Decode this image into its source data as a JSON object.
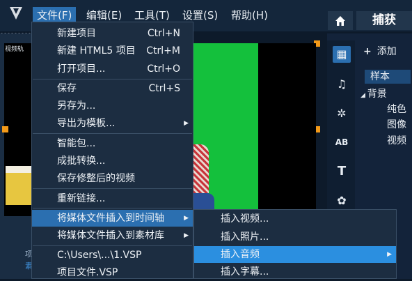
{
  "menubar": {
    "items": [
      "文件(F)",
      "编辑(E)",
      "工具(T)",
      "设置(S)",
      "帮助(H)"
    ]
  },
  "header": {
    "capture_label": "捕获"
  },
  "preview": {
    "track_label": "视频轨"
  },
  "file_menu": {
    "groups": [
      [
        {
          "label": "新建项目",
          "shortcut": "Ctrl+N"
        },
        {
          "label": "新建 HTML5 项目",
          "shortcut": "Ctrl+M"
        },
        {
          "label": "打开项目...",
          "shortcut": "Ctrl+O"
        }
      ],
      [
        {
          "label": "保存",
          "shortcut": "Ctrl+S"
        },
        {
          "label": "另存为..."
        },
        {
          "label": "导出为模板...",
          "submenu": true
        }
      ],
      [
        {
          "label": "智能包..."
        },
        {
          "label": "成批转换..."
        },
        {
          "label": "保存修整后的视频"
        }
      ],
      [
        {
          "label": "重新链接..."
        }
      ],
      [
        {
          "label": "将媒体文件插入到时间轴",
          "submenu": true,
          "highlighted": true
        },
        {
          "label": "将媒体文件插入到素材库",
          "submenu": true
        }
      ],
      [
        {
          "label": "C:\\Users\\...\\1.VSP"
        },
        {
          "label": "项目文件.VSP"
        }
      ]
    ]
  },
  "insert_submenu": {
    "items": [
      {
        "label": "插入视频..."
      },
      {
        "label": "插入照片..."
      },
      {
        "label": "插入音频",
        "submenu": true,
        "highlighted": true
      },
      {
        "label": "插入字幕..."
      }
    ]
  },
  "library": {
    "add_label": "添加",
    "tree": [
      {
        "label": "样本",
        "selected": true
      },
      {
        "label": "背景",
        "expanded": true
      },
      {
        "label": "纯色"
      },
      {
        "label": "图像"
      },
      {
        "label": "视频"
      }
    ],
    "tools": [
      "media-icon",
      "music-note-icon",
      "effects-icon",
      "ab-transition-icon",
      "title-t-icon",
      "graphics-icon"
    ]
  },
  "bottom_left": {
    "lines": [
      "项",
      "素"
    ]
  },
  "colors": {
    "accent": "#2b6fb0",
    "highlight": "#2b8fe0",
    "green_screen": "#14c03c",
    "handle": "#f39a19"
  }
}
